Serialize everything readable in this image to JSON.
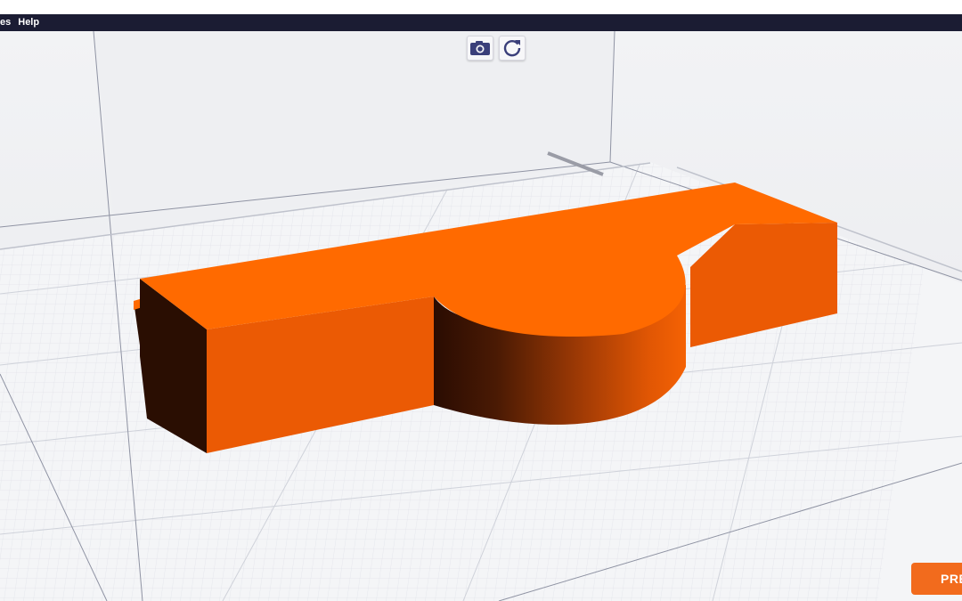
{
  "menubar": {
    "items": [
      "es",
      "Help"
    ]
  },
  "toolbar": {
    "camera_icon": "camera-icon",
    "rotate_icon": "rotate-reset-icon"
  },
  "actions": {
    "prepare_label": "PRE"
  },
  "colors": {
    "menubar_bg": "#1b1c33",
    "model_top": "#ff6a00",
    "model_front": "#eb5a04",
    "model_shadow": "#2a0e02",
    "plate_grid": "#d7d9e0",
    "prepare_button": "#f26b1d",
    "toolbar_icon": "#3a3f7a"
  }
}
